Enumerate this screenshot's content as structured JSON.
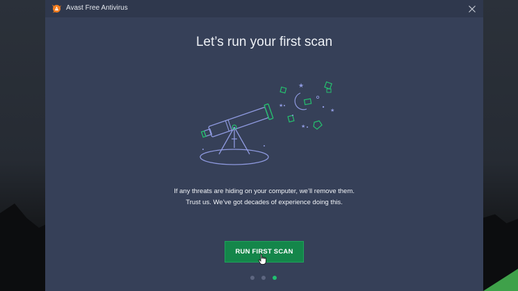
{
  "window": {
    "title": "Avast Free Antivirus",
    "close_icon": "close-icon",
    "logo_icon": "avast-logo"
  },
  "main": {
    "heading": "Let’s run your first scan",
    "description_line1": "If any threats are hiding on your computer, we’ll remove them.",
    "description_line2": "Trust us. We’ve got decades of experience doing this.",
    "cta_label": "RUN FIRST SCAN",
    "illustration": "telescope-with-stars-icon"
  },
  "pager": {
    "total": 3,
    "active_index": 3
  },
  "colors": {
    "window_bg": "#364058",
    "titlebar_bg": "#2f384d",
    "accent_green": "#14864a",
    "dot_active": "#20c070",
    "dot_inactive": "#5d6680",
    "brand_orange": "#f47d20"
  }
}
